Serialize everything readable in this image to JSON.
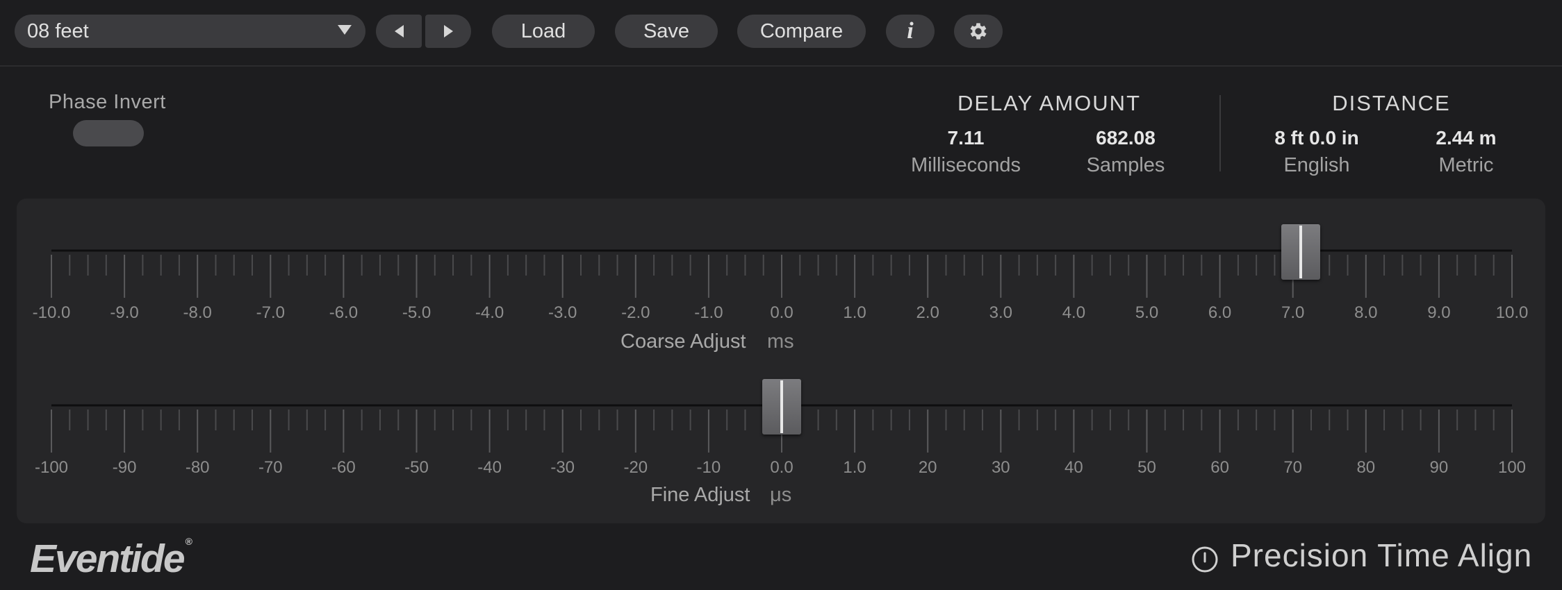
{
  "toolbar": {
    "preset_name": "08 feet",
    "load_label": "Load",
    "save_label": "Save",
    "compare_label": "Compare",
    "info_label": "i"
  },
  "phase_invert": {
    "label": "Phase Invert",
    "on": false
  },
  "delay_amount": {
    "header": "DELAY AMOUNT",
    "ms_value": "7.11",
    "ms_unit": "Milliseconds",
    "samples_value": "682.08",
    "samples_unit": "Samples"
  },
  "distance": {
    "header": "DISTANCE",
    "english_value": "8 ft 0.0 in",
    "english_unit": "English",
    "metric_value": "2.44 m",
    "metric_unit": "Metric"
  },
  "coarse": {
    "label": "Coarse Adjust",
    "unit": "ms",
    "min": -10.0,
    "max": 10.0,
    "value": 7.11,
    "ticks": [
      "-10.0",
      "-9.0",
      "-8.0",
      "-7.0",
      "-6.0",
      "-5.0",
      "-4.0",
      "-3.0",
      "-2.0",
      "-1.0",
      "0.0",
      "1.0",
      "2.0",
      "3.0",
      "4.0",
      "5.0",
      "6.0",
      "7.0",
      "8.0",
      "9.0",
      "10.0"
    ]
  },
  "fine": {
    "label": "Fine Adjust",
    "unit": "μs",
    "min": -100,
    "max": 100,
    "value": 0,
    "ticks": [
      "-100",
      "-90",
      "-80",
      "-70",
      "-60",
      "-50",
      "-40",
      "-30",
      "-20",
      "-10",
      "0.0",
      "1.0",
      "20",
      "30",
      "40",
      "50",
      "60",
      "70",
      "80",
      "90",
      "100"
    ]
  },
  "footer": {
    "brand": "Eventide",
    "brand_mark": "®",
    "product": "Precision Time Align"
  },
  "colors": {
    "background": "#1d1d1f",
    "panel": "#262628",
    "pill": "#3b3b3e",
    "thumb_line": "#e8e8e8"
  },
  "icons": [
    "chevron-down-icon",
    "arrow-left-icon",
    "arrow-right-icon",
    "info-icon",
    "gear-icon",
    "power-icon"
  ]
}
